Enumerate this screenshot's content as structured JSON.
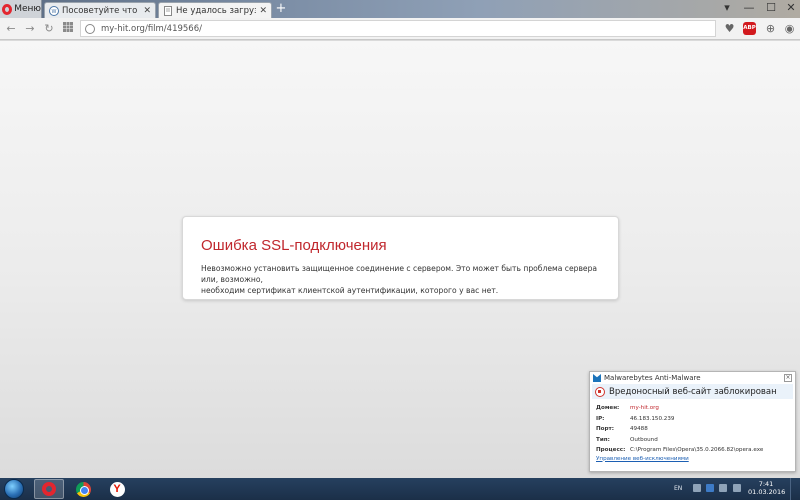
{
  "browser": {
    "menu_label": "Меню",
    "tabs": [
      {
        "title": "Посоветуйте что посмотр",
        "close": "✕",
        "active": false
      },
      {
        "title": "Не удалось загрузить http",
        "close": "✕",
        "active": true
      }
    ],
    "new_tab": "+",
    "window_controls": {
      "chevron": "▾",
      "minimize": "—",
      "maximize": "☐",
      "close": "✕"
    },
    "address_url": "my-hit.org/film/419566/",
    "adblock_label": "ABP"
  },
  "error": {
    "title": "Ошибка SSL-подключения",
    "message_line1": "Невозможно установить защищенное соединение с сервером. Это может быть проблема сервера или, возможно,",
    "message_line2": "необходим сертификат клиентской аутентификации, которого у вас нет."
  },
  "malwarebytes": {
    "app_name": "Malwarebytes Anti-Malware",
    "banner": "Вредоносный веб-сайт заблокирован",
    "rows": [
      {
        "key": "Домен:",
        "value": "my-hit.org",
        "red": true
      },
      {
        "key": "IP:",
        "value": "46.183.150.239",
        "red": false
      },
      {
        "key": "Порт:",
        "value": "49488",
        "red": false
      },
      {
        "key": "Тип:",
        "value": "Outbound",
        "red": false
      },
      {
        "key": "Процесс:",
        "value": "C:\\Program Files\\Opera\\35.0.2066.82\\opera.exe",
        "red": false
      }
    ],
    "manage_link": "Управление веб-исключениями"
  },
  "taskbar": {
    "language": "EN",
    "time": "7:41",
    "date": "01.03.2016",
    "yandex_letter": "Y"
  },
  "colors": {
    "error_red": "#c0272d",
    "opera_red": "#e3262f",
    "link_blue": "#1c5fb3"
  }
}
